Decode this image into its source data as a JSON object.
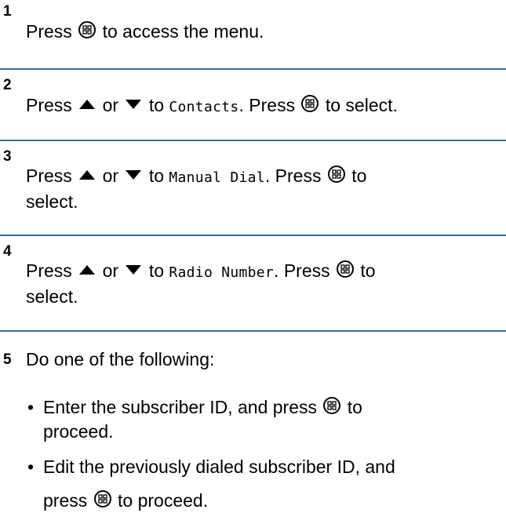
{
  "steps": [
    {
      "number": "1",
      "parts": {
        "a": "Press",
        "b": "to access the menu."
      }
    },
    {
      "number": "2",
      "parts": {
        "press": "Press",
        "or": "or",
        "to": "to",
        "mono": "Contacts",
        "press2": ". Press",
        "end": "to select."
      }
    },
    {
      "number": "3",
      "parts": {
        "press": "Press",
        "or": "or",
        "to": "to",
        "mono": "Manual Dial",
        "press2": ". Press",
        "end": "to",
        "line2": "select."
      }
    },
    {
      "number": "4",
      "parts": {
        "press": "Press",
        "or": "or",
        "to": "to",
        "mono": "Radio Number",
        "press2": ". Press",
        "end": "to",
        "line2": "select."
      }
    },
    {
      "number": "5",
      "intro": "Do one of the following:",
      "bullets": [
        {
          "dot": "•",
          "line1_pre": "Enter the subscriber ID, and press",
          "line1_post": "to",
          "line2": "proceed."
        },
        {
          "dot": "•",
          "line1": "Edit the previously dialed subscriber ID, and",
          "line2_pre": "press",
          "line2_post": "to proceed."
        }
      ]
    }
  ],
  "icons": {
    "ok_key": "menu-ok-button-icon",
    "up": "up-arrow-icon",
    "down": "down-arrow-icon"
  },
  "colors": {
    "divider": "#2f6eb5",
    "text": "#000000"
  }
}
